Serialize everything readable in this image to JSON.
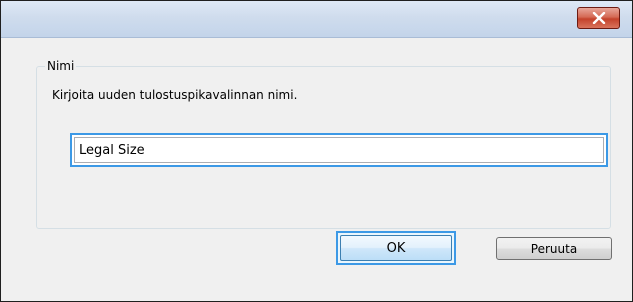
{
  "window": {
    "title": "",
    "close_icon": "close-icon"
  },
  "group": {
    "legend": "Nimi",
    "instruction": "Kirjoita uuden tulostuspikavalinnan nimi."
  },
  "name_input": {
    "value": "Legal Size"
  },
  "buttons": {
    "ok_label": "OK",
    "cancel_label": "Peruuta"
  },
  "colors": {
    "focus_accent": "#3c99e6",
    "close_button": "#c4422b",
    "dialog_background": "#f0f0f0"
  }
}
